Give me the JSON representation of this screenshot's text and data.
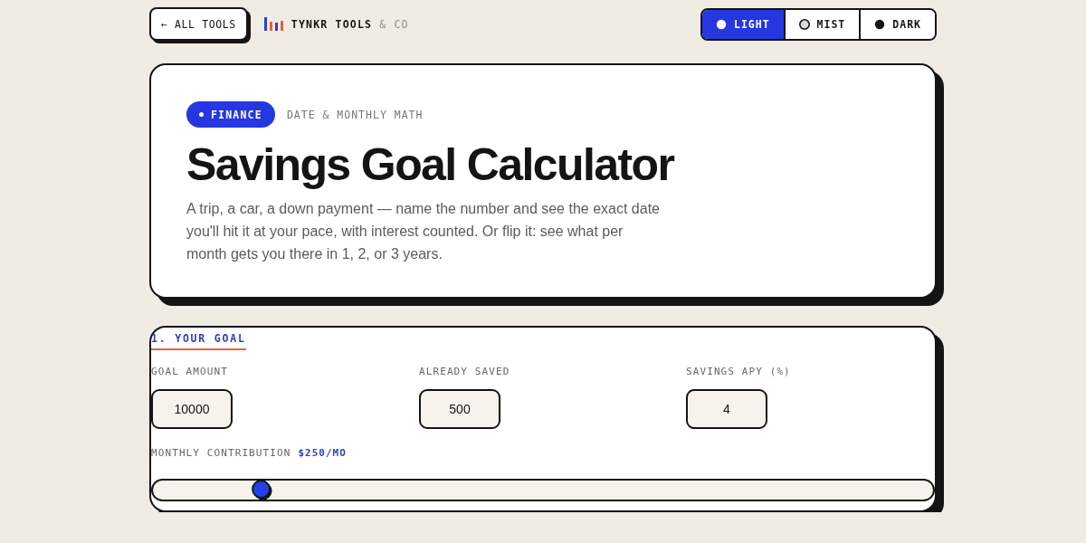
{
  "nav": {
    "back_button": "← ALL TOOLS",
    "brand": {
      "name": "TYNKR TOOLS",
      "suffix": "& CO"
    }
  },
  "theme_switch": [
    {
      "label": "LIGHT",
      "kind": "light",
      "selected": true
    },
    {
      "label": "MIST",
      "kind": "mist",
      "selected": false
    },
    {
      "label": "DARK",
      "kind": "dark",
      "selected": false
    }
  ],
  "hero": {
    "badge": "FINANCE",
    "tagline": "DATE & MONTHLY MATH",
    "title": "Savings Goal Calculator",
    "description": "A trip, a car, a down payment — name the number and see the exact date you'll hit it at your pace, with interest counted. Or flip it: see what per month gets you there in 1, 2, or 3 years."
  },
  "goal_section": {
    "heading": "1. YOUR GOAL",
    "fields": [
      {
        "label": "GOAL AMOUNT",
        "value": "10000"
      },
      {
        "label": "ALREADY SAVED",
        "value": "500"
      },
      {
        "label": "SAVINGS APY (%)",
        "value": "4"
      }
    ],
    "contribution": {
      "label": "MONTHLY CONTRIBUTION",
      "reading": "$250/MO",
      "level": 0.13
    }
  }
}
